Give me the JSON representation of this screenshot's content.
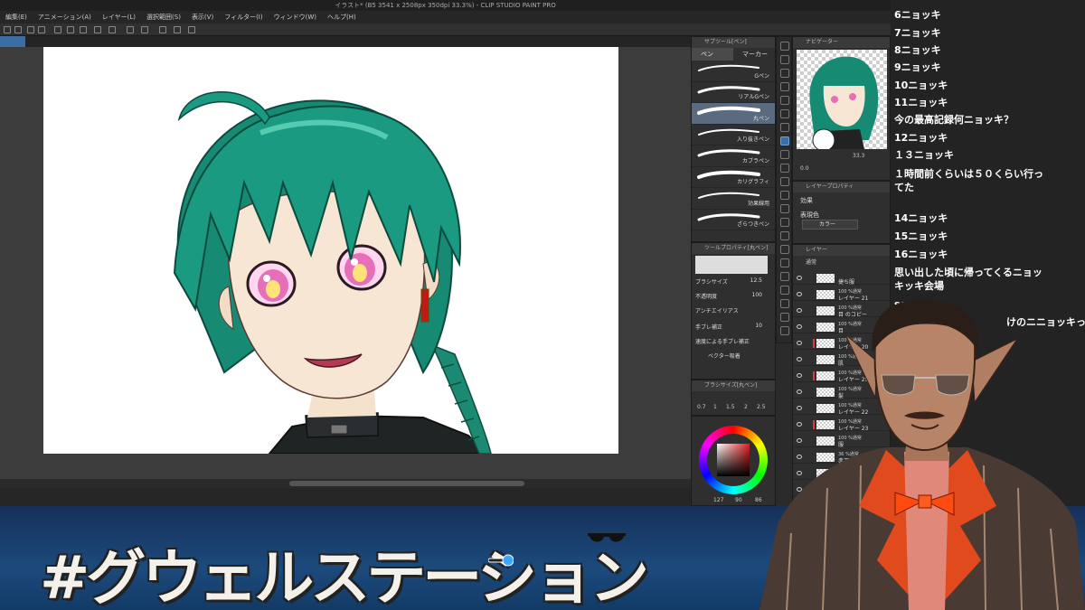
{
  "app": {
    "title": "イラスト* (B5 3541 x 2508px 350dpi 33.3%) - CLIP STUDIO PAINT PRO",
    "menu": [
      "編集(E)",
      "アニメーション(A)",
      "レイヤー(L)",
      "選択範囲(S)",
      "表示(V)",
      "フィルター(I)",
      "ウィンドウ(W)",
      "ヘルプ(H)"
    ]
  },
  "subtool_panel": {
    "header": "サブツール[ペン]",
    "tabs": [
      "ペン",
      "マーカー"
    ],
    "brushes": [
      {
        "name": "Gペン",
        "selected": false
      },
      {
        "name": "リアルGペン",
        "selected": false
      },
      {
        "name": "丸ペン",
        "selected": true
      },
      {
        "name": "入り抜きペン",
        "selected": false
      },
      {
        "name": "カブラペン",
        "selected": false
      },
      {
        "name": "カリグラフィ",
        "selected": false
      },
      {
        "name": "効果線用",
        "selected": false
      },
      {
        "name": "ざらつきペン",
        "selected": false
      }
    ]
  },
  "navigator": {
    "header": "ナビゲーター",
    "zoom": "33.3",
    "angle": "0.0"
  },
  "layer_property": {
    "header": "レイヤープロパティ",
    "effect_label": "効果",
    "expression_label": "表現色",
    "expression_value": "カラー"
  },
  "tool_property": {
    "header": "ツールプロパティ[丸ペン]",
    "brush_size_label": "ブラシサイズ",
    "brush_size_value": "12.5",
    "opacity_label": "不透明度",
    "opacity_value": "100",
    "antialias_label": "アンチエイリアス",
    "stabilization_label": "手ブレ補正",
    "stabilization_value": "10",
    "speed_label": "速度による手ブレ補正",
    "vector_label": "ベクター吸着"
  },
  "brush_size_panel": {
    "header": "ブラシサイズ[丸ペン]",
    "sizes": [
      "0.7",
      "1",
      "1.5",
      "2",
      "2.5"
    ]
  },
  "color": {
    "r": "127",
    "g": "90",
    "b": "86",
    "current": "#e02020"
  },
  "layers": {
    "header": "レイヤー",
    "blend_mode": "通常",
    "rows": [
      {
        "pct": "",
        "name": "捷ち服",
        "mark": false
      },
      {
        "pct": "100 %通常",
        "name": "レイヤー 21",
        "mark": false
      },
      {
        "pct": "100 %通常",
        "name": "目 のコピー",
        "mark": false
      },
      {
        "pct": "100 %通常",
        "name": "目",
        "mark": false
      },
      {
        "pct": "100 %通常",
        "name": "レイヤー 20",
        "mark": true
      },
      {
        "pct": "100 %通常",
        "name": "肌",
        "mark": false
      },
      {
        "pct": "100 %通常",
        "name": "レイヤー 25",
        "mark": true
      },
      {
        "pct": "100 %通常",
        "name": "髪",
        "mark": false
      },
      {
        "pct": "100 %通常",
        "name": "レイヤー 22",
        "mark": false
      },
      {
        "pct": "100 %通常",
        "name": "レイヤー 23",
        "mark": true
      },
      {
        "pct": "100 %通常",
        "name": "服",
        "mark": false
      },
      {
        "pct": "36 %通常",
        "name": "赤下書き",
        "mark": false
      },
      {
        "pct": "36 %通常",
        "name": "青下書き",
        "mark": false
      },
      {
        "pct": "",
        "name": "用紙",
        "mark": false
      }
    ]
  },
  "chat": [
    "6ニョッキ",
    "7ニョッキ",
    "8ニョッキ",
    "9ニョッキ",
    "10ニョッキ",
    "11ニョッキ",
    "今の最高記録何ニョッキ？",
    "12ニョッキ",
    "１３ニョッキ",
    "１時間前くらいは５０くらい行っ",
    "てた",
    "14ニョッキ",
    "15ニョッキ",
    "16ニョッキ",
    "思い出した頃に帰ってくるニョッ",
    "キッキ会場",
    "sor",
    "けのニニョッキっ"
  ],
  "banner": {
    "title": "#グウェルステーション"
  },
  "icons": {
    "visibility": "eye-icon",
    "sunglasses": "sunglasses-icon",
    "microphone": "microphone-icon"
  }
}
